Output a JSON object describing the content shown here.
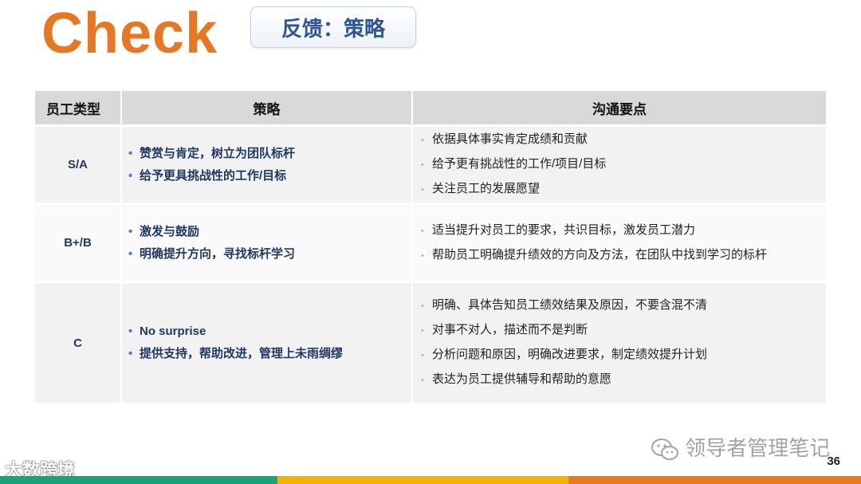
{
  "header": {
    "title": "Check",
    "badge": "反馈：策略"
  },
  "colors": {
    "title": "#e87722",
    "badge_text": "#2f5597",
    "footer_green": "#1aa37a",
    "footer_yellow": "#f2b300",
    "footer_orange": "#ea7a1f"
  },
  "table": {
    "headers": [
      "员工类型",
      "策略",
      "沟通要点"
    ],
    "rows": [
      {
        "type": "S/A",
        "strategy": [
          "赞赏与肯定，树立为团队标杆",
          "给予更具挑战性的工作/目标"
        ],
        "points": [
          "依据具体事实肯定成绩和贡献",
          "给予更有挑战性的工作/项目/目标",
          "关注员工的发展愿望"
        ]
      },
      {
        "type": "B+/B",
        "strategy": [
          "激发与鼓励",
          "明确提升方向，寻找标杆学习"
        ],
        "points": [
          "适当提升对员工的要求，共识目标，激发员工潜力",
          "帮助员工明确提升绩效的方向及方法，在团队中找到学习的标杆"
        ]
      },
      {
        "type": "C",
        "strategy": [
          "No surprise",
          "提供支持，帮助改进，管理上未雨绸缪"
        ],
        "points": [
          "明确、具体告知员工绩效结果及原因，不要含混不清",
          "对事不对人，描述而不是判断",
          "分析问题和原因，明确改进要求，制定绩效提升计划",
          "表达为员工提供辅导和帮助的意愿"
        ]
      }
    ]
  },
  "footer": {
    "watermark": "领导者管理笔记",
    "page_number": "36",
    "logo_text": "大数跨境",
    "watermark_icon": "wechat-icon"
  }
}
